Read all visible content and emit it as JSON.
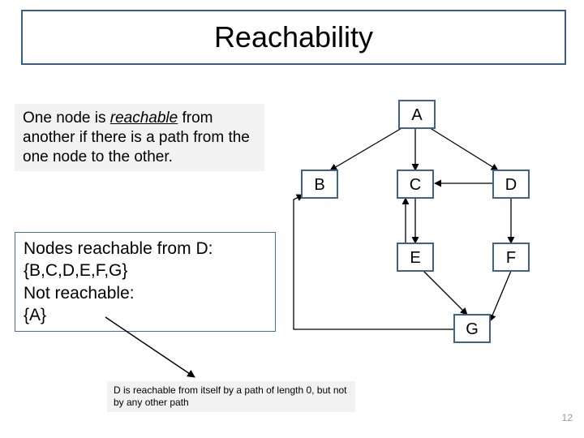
{
  "title": "Reachability",
  "definition_pre": "One node is ",
  "definition_em": "reachable",
  "definition_post": " from another if there is a path from the one node to the other.",
  "example_l1": "Nodes reachable from D:",
  "example_l2": "{B,C,D,E,F,G}",
  "example_l3": "Not reachable:",
  "example_l4": "{A}",
  "note": "D is reachable from itself by a path of length 0, but not by any other path",
  "page": "12",
  "nodes": {
    "A": "A",
    "B": "B",
    "C": "C",
    "D": "D",
    "E": "E",
    "F": "F",
    "G": "G"
  }
}
